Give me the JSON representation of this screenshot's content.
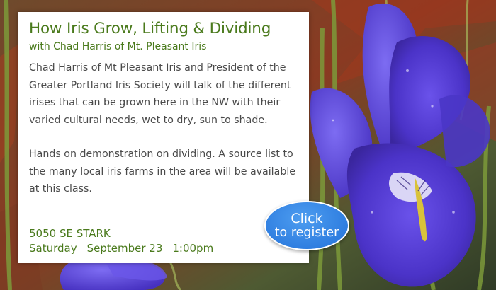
{
  "event": {
    "title": "How Iris Grow, Lifting & Dividing",
    "subtitle": "with Chad Harris of Mt. Pleasant Iris",
    "description_1": "Chad Harris of Mt Pleasant Iris and President of the Greater Portland Iris Society will talk of the different irises that can be grown here in the NW with their varied cultural needs, wet to dry, sun to shade.",
    "description_2": "Hands on demonstration on dividing. A source list to the many local iris farms in the area will be available at this class.",
    "address": "5050 SE STARK",
    "day": "Saturday",
    "date": "September 23",
    "time": "1:00pm"
  },
  "register_button": {
    "line1": "Click",
    "line2": "to register",
    "color": "#2f7ee0"
  },
  "colors": {
    "heading_green": "#4a7a1c",
    "body_gray": "#4a4a4a",
    "iris_purple": "#5b3fd6"
  }
}
